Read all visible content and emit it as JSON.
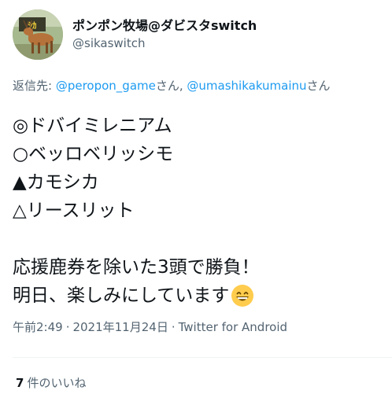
{
  "author": {
    "display_name": "ポンポン牧場@ダビスタswitch",
    "handle": "@sikaswitch"
  },
  "reply": {
    "prefix": "返信先: ",
    "mention1": "@peropon_game",
    "suffix1": "さん, ",
    "mention2": "@umashikakumainu",
    "suffix2": "さん"
  },
  "tweet": {
    "lines": [
      "◎ドバイミレニアム",
      "○ベッロベリッシモ",
      "▲カモシカ",
      "△リースリット",
      "",
      "応援鹿券を除いた3頭で勝負！",
      "明日、楽しみにしています"
    ],
    "emoji": "grinning-face-with-smiling-eyes"
  },
  "meta": {
    "time": "午前2:49",
    "separator": "·",
    "date": "2021年11月24日",
    "client": "Twitter for Android"
  },
  "stats": {
    "likes_count": "7",
    "likes_label": "件のいいね"
  },
  "colors": {
    "link": "#1d9bf0",
    "secondary_text": "#536471",
    "primary_text": "#0f1419",
    "divider": "#eff3f4"
  }
}
